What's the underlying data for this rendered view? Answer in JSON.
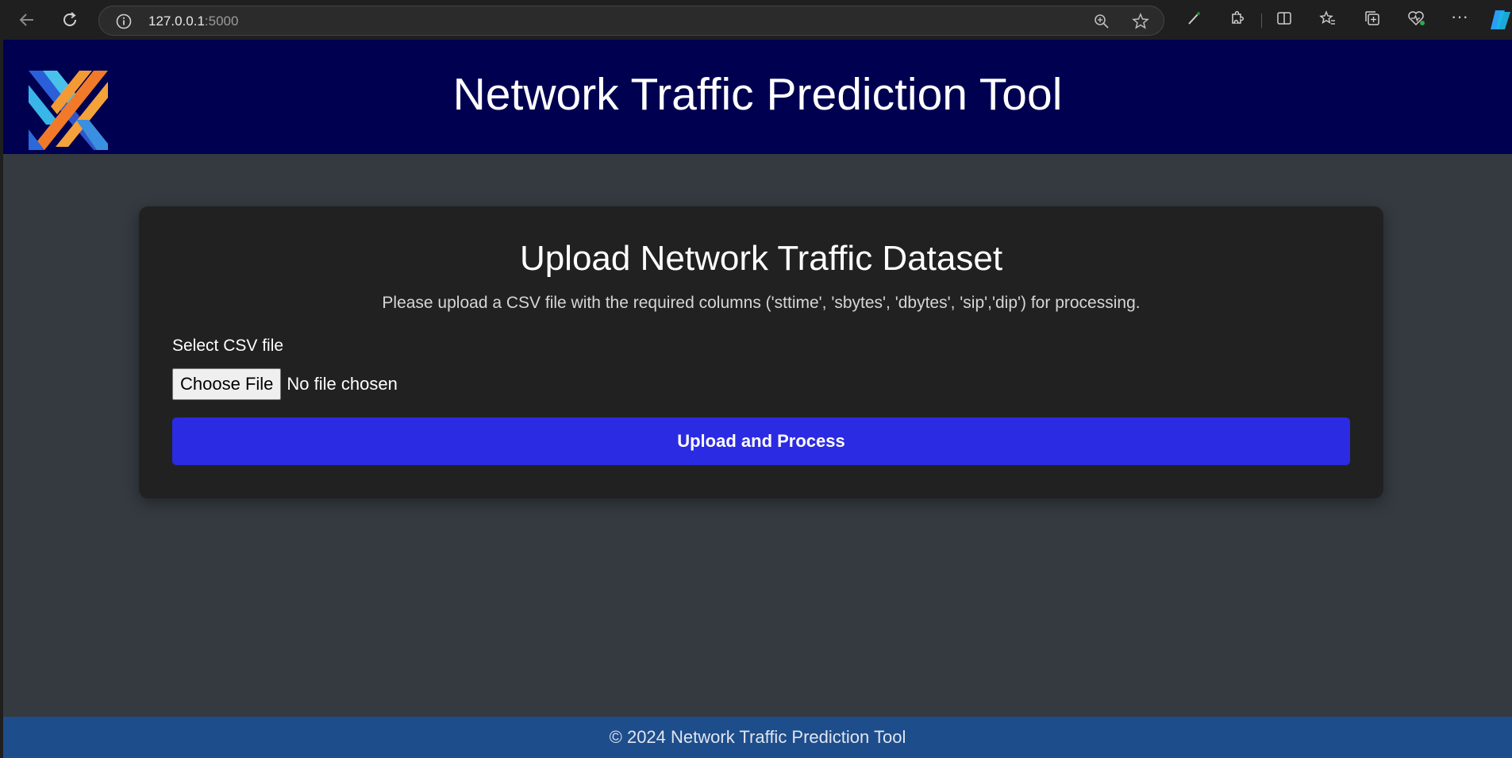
{
  "browser": {
    "url_host": "127.0.0.1",
    "url_port": ":5000"
  },
  "header": {
    "title": "Network Traffic Prediction Tool",
    "logo_icon": "x-logo-icon"
  },
  "card": {
    "title": "Upload Network Traffic Dataset",
    "description": "Please upload a CSV file with the required columns ('sttime', 'sbytes', 'dbytes', 'sip','dip') for processing.",
    "file_label": "Select CSV file",
    "choose_button": "Choose File",
    "file_status": "No file chosen",
    "submit_button": "Upload and Process"
  },
  "footer": {
    "text": "© 2024 Network Traffic Prediction Tool"
  },
  "colors": {
    "header_bg": "#000050",
    "page_bg": "#343a40",
    "card_bg": "#212121",
    "button_bg": "#2b2be3",
    "footer_bg": "#1e4d8c"
  }
}
